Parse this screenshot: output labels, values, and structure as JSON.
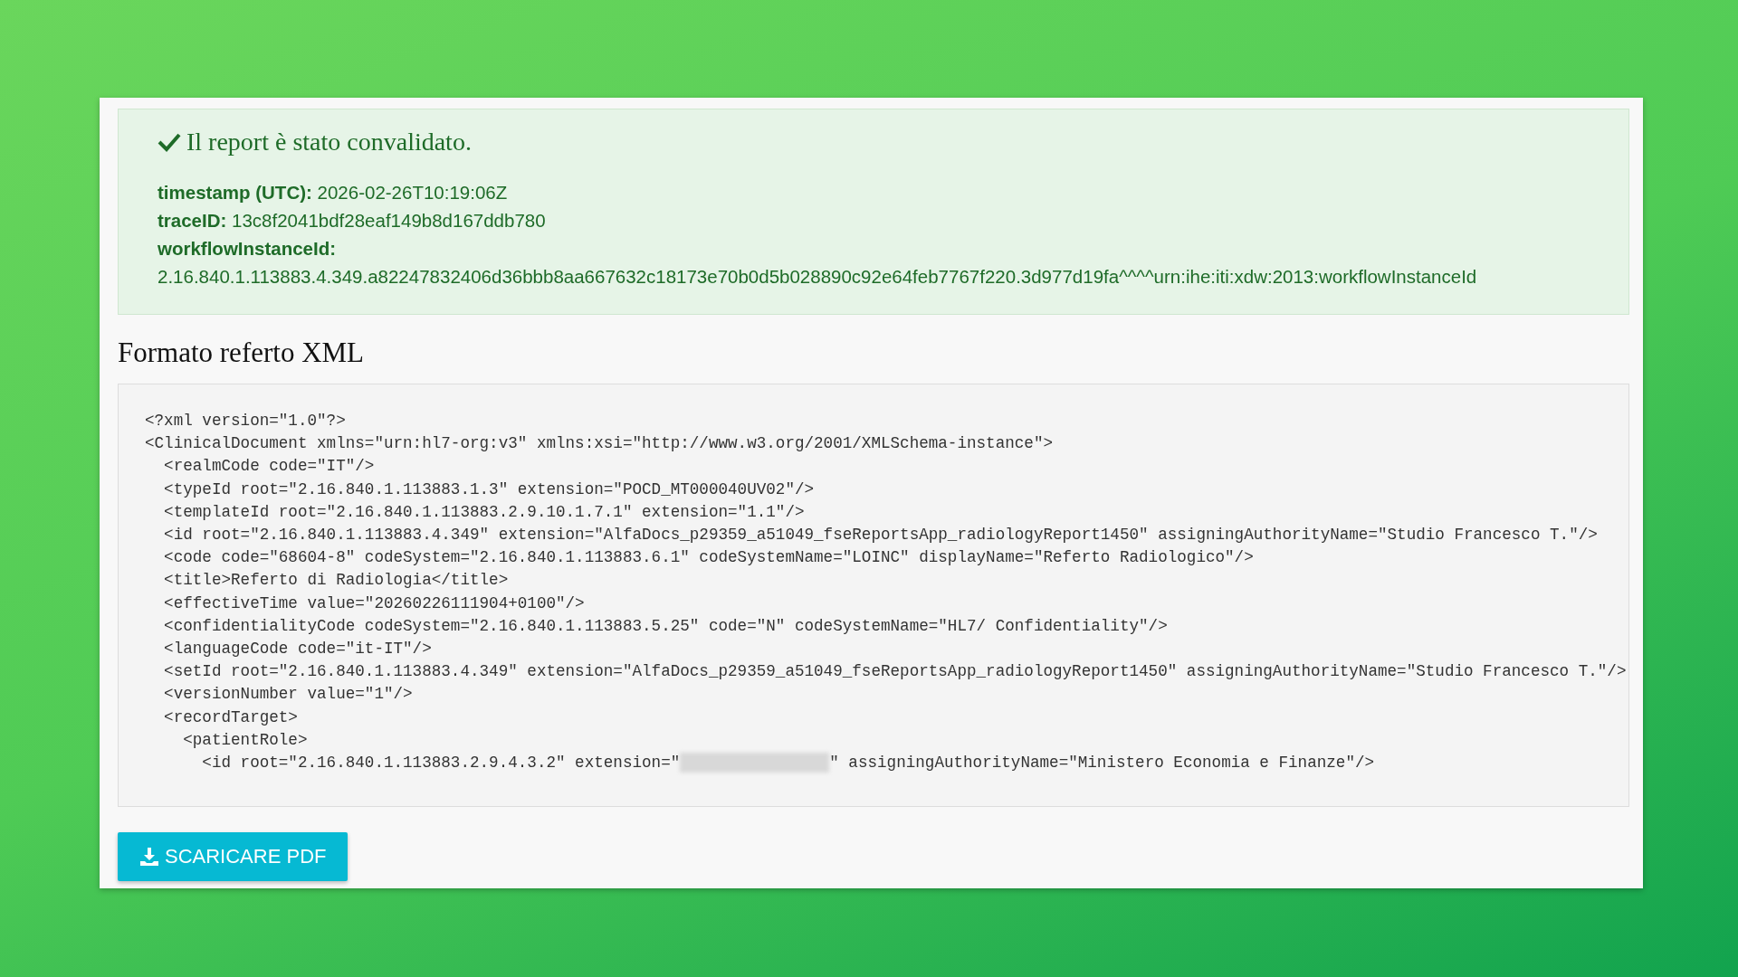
{
  "alert": {
    "title": "Il report è stato convalidato.",
    "fields": [
      {
        "label": "timestamp (UTC):",
        "value": "2026-02-26T10:19:06Z",
        "kind": "inline"
      },
      {
        "label": "traceID:",
        "value": "13c8f2041bdf28eaf149b8d167ddb780",
        "kind": "inline"
      },
      {
        "label": "workflowInstanceId:",
        "value": "2.16.840.1.113883.4.349.a82247832406d36bbb8aa667632c18173e70b0d5b028890c92e64feb7767f220.3d977d19fa^^^^urn:ihe:iti:xdw:2013:workflowInstanceId",
        "kind": "block"
      }
    ]
  },
  "section_title": "Formato referto XML",
  "xml_lines": [
    {
      "kind": "plain",
      "text": "<?xml version=\"1.0\"?>"
    },
    {
      "kind": "plain",
      "text": "<ClinicalDocument xmlns=\"urn:hl7-org:v3\" xmlns:xsi=\"http://www.w3.org/2001/XMLSchema-instance\">"
    },
    {
      "kind": "plain",
      "text": "  <realmCode code=\"IT\"/>"
    },
    {
      "kind": "plain",
      "text": "  <typeId root=\"2.16.840.1.113883.1.3\" extension=\"POCD_MT000040UV02\"/>"
    },
    {
      "kind": "plain",
      "text": "  <templateId root=\"2.16.840.1.113883.2.9.10.1.7.1\" extension=\"1.1\"/>"
    },
    {
      "kind": "plain",
      "text": "  <id root=\"2.16.840.1.113883.4.349\" extension=\"AlfaDocs_p29359_a51049_fseReportsApp_radiologyReport1450\" assigningAuthorityName=\"Studio Francesco T.\"/>"
    },
    {
      "kind": "plain",
      "text": "  <code code=\"68604-8\" codeSystem=\"2.16.840.1.113883.6.1\" codeSystemName=\"LOINC\" displayName=\"Referto Radiologico\"/>"
    },
    {
      "kind": "plain",
      "text": "  <title>Referto di Radiologia</title>"
    },
    {
      "kind": "plain",
      "text": "  <effectiveTime value=\"20260226111904+0100\"/>"
    },
    {
      "kind": "plain",
      "text": "  <confidentialityCode codeSystem=\"2.16.840.1.113883.5.25\" code=\"N\" codeSystemName=\"HL7/ Confidentiality\"/>"
    },
    {
      "kind": "plain",
      "text": "  <languageCode code=\"it-IT\"/>"
    },
    {
      "kind": "plain",
      "text": "  <setId root=\"2.16.840.1.113883.4.349\" extension=\"AlfaDocs_p29359_a51049_fseReportsApp_radiologyReport1450\" assigningAuthorityName=\"Studio Francesco T.\"/>"
    },
    {
      "kind": "plain",
      "text": "  <versionNumber value=\"1\"/>"
    },
    {
      "kind": "plain",
      "text": "  <recordTarget>"
    },
    {
      "kind": "plain",
      "text": "    <patientRole>"
    },
    {
      "kind": "redacted",
      "before": "      <id root=\"2.16.840.1.113883.2.9.4.3.2\" extension=\"",
      "after": "\" assigningAuthorityName=\"Ministero Economia e Finanze\"/>"
    }
  ],
  "download_button": {
    "label": "SCARICARE PDF"
  }
}
